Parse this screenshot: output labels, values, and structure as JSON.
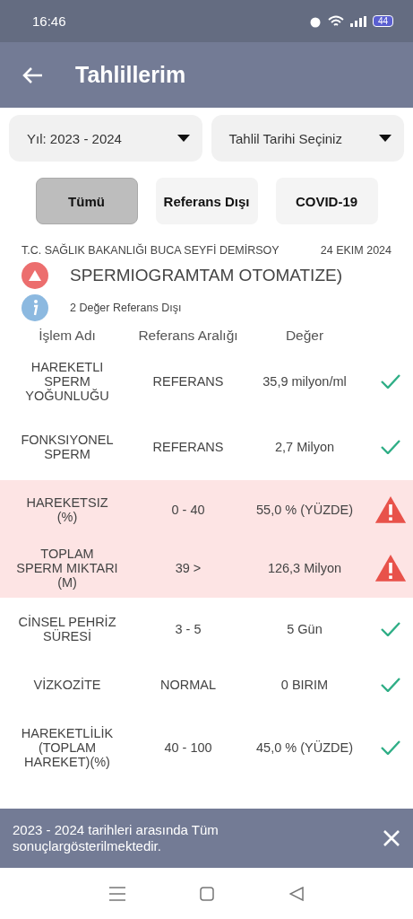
{
  "status_bar": {
    "time": "16:46",
    "battery": "44"
  },
  "app_bar": {
    "title": "Tahlillerim"
  },
  "dropdowns": [
    {
      "label": "Yıl: 2023 - 2024"
    },
    {
      "label": "Tahlil Tarihi Seçiniz"
    }
  ],
  "filters": [
    {
      "label": "Tümü",
      "selected": true
    },
    {
      "label": "Referans Dışı",
      "selected": false
    },
    {
      "label": "COVID-19",
      "selected": false
    }
  ],
  "lab": {
    "name": "T.C. SAĞLIK BAKANLIĞI BUCA SEYFİ DEMİRSOY",
    "date": "24 EKIM 2024"
  },
  "test": {
    "title": "SPERMIOGRAMTAM OTOMATIZE)",
    "summary": "2 Değer Referans Dışı"
  },
  "table": {
    "columns": [
      "İşlem Adı",
      "Referans Aralığı",
      "Değer"
    ],
    "rows": [
      {
        "name": "HAREKETLI SPERM YOĞUNLUĞU",
        "range": "REFERANS",
        "value": "35,9 milyon/ml",
        "out_of_range": false
      },
      {
        "name": "FONKSIYONEL SPERM",
        "range": "REFERANS",
        "value": "2,7 Milyon",
        "out_of_range": false
      },
      {
        "name": "HAREKETSIZ (%)",
        "range": "0 - 40",
        "value": "55,0 % (YÜZDE)",
        "out_of_range": true
      },
      {
        "name": "TOPLAM SPERM MIKTARI (M)",
        "range": "39 >",
        "value": "126,3 Milyon",
        "out_of_range": true
      },
      {
        "name": "CİNSEL PEHRİZ SÜRESİ",
        "range": "3 - 5",
        "value": "5 Gün",
        "out_of_range": false
      },
      {
        "name": "VİZKOZİTE",
        "range": "NORMAL",
        "value": "0 BIRIM",
        "out_of_range": false
      },
      {
        "name": "HAREKETLİLİK (TOPLAM HAREKET)(%)",
        "range": "40 - 100",
        "value": "45,0 % (YÜZDE)",
        "out_of_range": false
      }
    ]
  },
  "snackbar": {
    "message": "2023 - 2024 tarihleri arasında Tüm sonuçlargösterilmektedir."
  }
}
